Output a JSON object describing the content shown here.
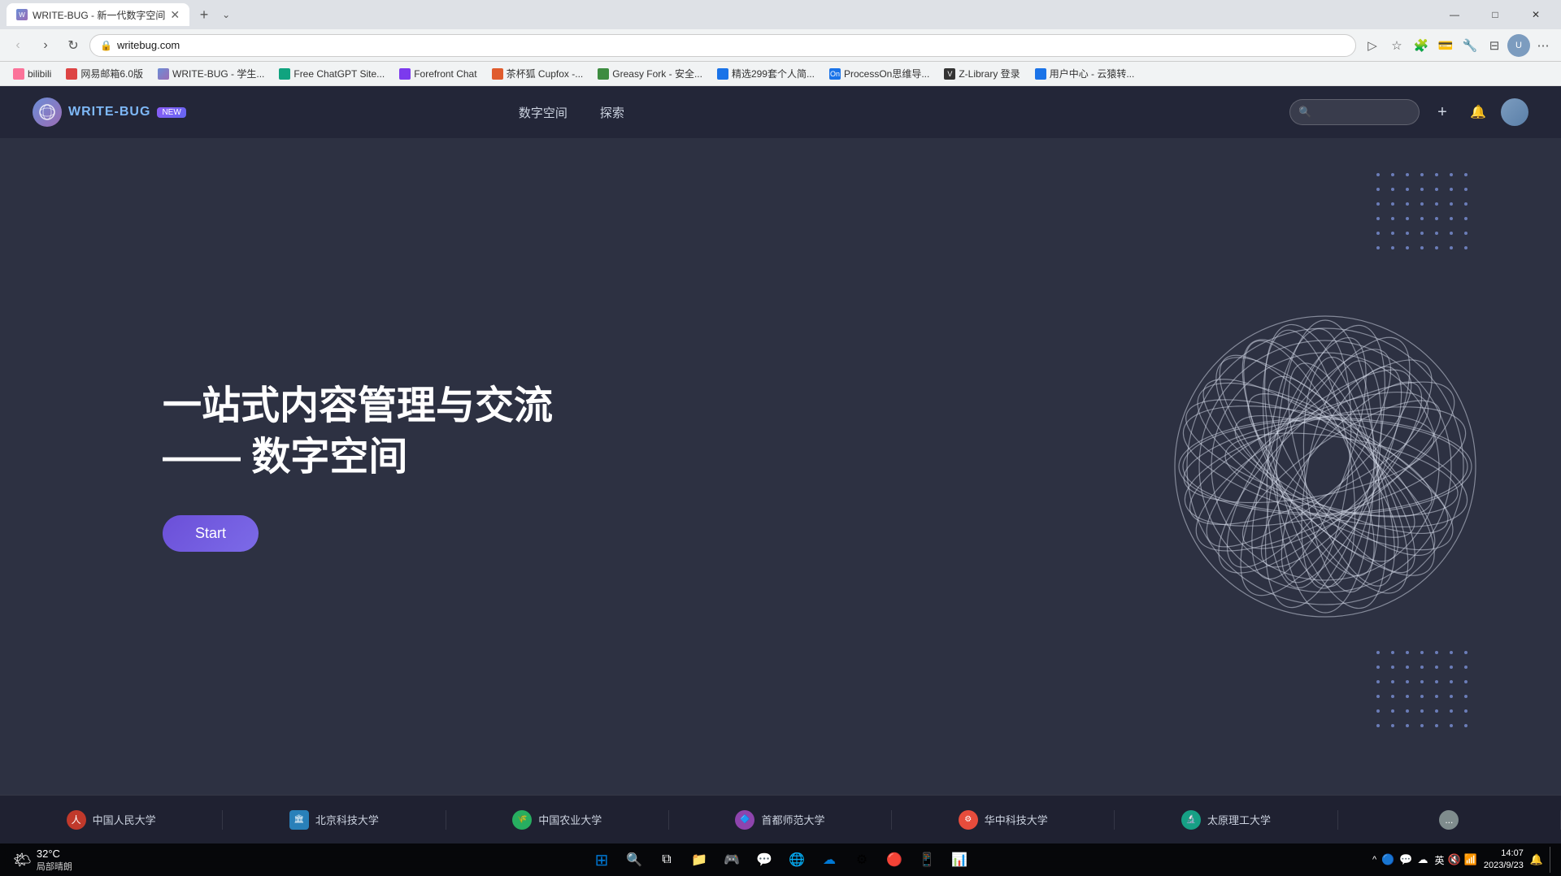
{
  "browser": {
    "tab": {
      "title": "WRITE-BUG - 新一代数字空间",
      "favicon_color": "#4a9ef5"
    },
    "url": "writebug.com",
    "window_controls": {
      "minimize": "—",
      "maximize": "□",
      "close": "✕"
    }
  },
  "bookmarks": [
    {
      "label": "bilibili",
      "color": "#fb7299",
      "id": "bilibili"
    },
    {
      "label": "网易邮箱6.0版",
      "color": "#d44",
      "id": "netease"
    },
    {
      "label": "WRITE-BUG - 学生...",
      "color": "#4a9ef5",
      "id": "writebug2"
    },
    {
      "label": "Free ChatGPT Site...",
      "color": "#10a37f",
      "id": "chatgpt"
    },
    {
      "label": "Forefront Chat",
      "color": "#7c3aed",
      "id": "forefront"
    },
    {
      "label": "茶杯狐 Cupfox -...",
      "color": "#e05c2e",
      "id": "cupfox"
    },
    {
      "label": "Greasy Fork - 安全...",
      "color": "#3d8c40",
      "id": "greasyfork"
    },
    {
      "label": "精选299套个人简...",
      "color": "#1a73e8",
      "id": "resume"
    },
    {
      "label": "ProcessOn思维导...",
      "color": "#1a73e8",
      "id": "processon"
    },
    {
      "label": "Z-Library 登录",
      "color": "#333",
      "id": "zlibrary"
    },
    {
      "label": "用户中心 - 云猿转...",
      "color": "#1a73e8",
      "id": "yuntech"
    }
  ],
  "site": {
    "logo_text": "WRITE-BUG",
    "badge": "NEW",
    "nav_links": [
      {
        "label": "数字空间"
      },
      {
        "label": "探索"
      }
    ],
    "hero": {
      "title_line1": "一站式内容管理与交流",
      "title_line2": "—— 数字空间",
      "start_button": "Start"
    },
    "universities": [
      {
        "label": "中国人民大学",
        "color": "#c0392b"
      },
      {
        "label": "北京科技大学",
        "color": "#2980b9"
      },
      {
        "label": "中国农业大学",
        "color": "#27ae60"
      },
      {
        "label": "首都师范大学",
        "color": "#8e44ad"
      },
      {
        "label": "华中科技大学",
        "color": "#e74c3c"
      },
      {
        "label": "太原理工大学",
        "color": "#16a085"
      },
      {
        "label": "...",
        "color": "#7f8c8d"
      }
    ]
  },
  "taskbar": {
    "weather": {
      "temp": "32°C",
      "desc": "局部晴朗",
      "icon": "🌤"
    },
    "clock": {
      "time": "14:07",
      "date": "2023/9/23"
    },
    "ime": "英",
    "apps": [
      {
        "name": "windows-start",
        "icon": "⊞",
        "color": "#0078d4"
      },
      {
        "name": "search",
        "icon": "🔍",
        "color": "white"
      },
      {
        "name": "file-explorer",
        "icon": "📁",
        "color": "#ffc107"
      },
      {
        "name": "app4",
        "icon": "🎮",
        "color": "#e74c3c"
      },
      {
        "name": "wechat",
        "icon": "💬",
        "color": "#07c160"
      },
      {
        "name": "chrome",
        "icon": "🌐",
        "color": "#4285f4"
      },
      {
        "name": "onedrive",
        "icon": "☁",
        "color": "#0078d4"
      },
      {
        "name": "app8",
        "icon": "⚙",
        "color": "#9b59b6"
      },
      {
        "name": "app9",
        "icon": "🔴",
        "color": "#e74c3c"
      },
      {
        "name": "phone",
        "icon": "📱",
        "color": "#333"
      },
      {
        "name": "excel",
        "icon": "📊",
        "color": "#217346"
      }
    ]
  }
}
